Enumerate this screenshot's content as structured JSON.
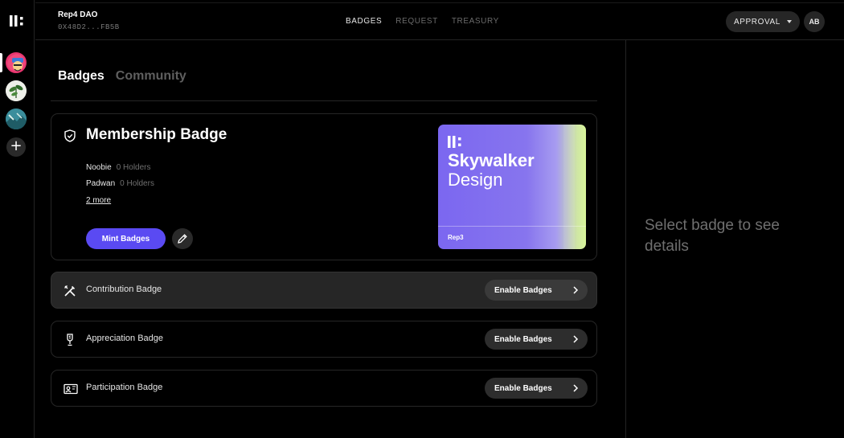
{
  "header": {
    "dao_name": "Rep4 DAO",
    "dao_address": "0X48D2...FB5B",
    "nav": [
      {
        "label": "BADGES",
        "active": true
      },
      {
        "label": "REQUEST",
        "active": false
      },
      {
        "label": "TREASURY",
        "active": false
      }
    ],
    "approval_label": "APPROVAL",
    "user_initials": "AB"
  },
  "rail": {
    "logo_icon": "rep3-logo-icon",
    "add_label": "+"
  },
  "tabs": [
    {
      "label": "Badges",
      "active": true
    },
    {
      "label": "Community",
      "active": false
    }
  ],
  "membership": {
    "title": "Membership Badge",
    "levels": [
      {
        "name": "Noobie",
        "holders": "0 Holders"
      },
      {
        "name": "Padwan",
        "holders": "0 Holders"
      }
    ],
    "more_link": "2 more",
    "mint_label": "Mint Badges",
    "preview": {
      "title": "Skywalker",
      "subtitle": "Design",
      "brand": "Rep3"
    }
  },
  "badge_rows": [
    {
      "label": "Contribution Badge",
      "button": "Enable Badges",
      "icon": "tools-icon"
    },
    {
      "label": "Appreciation Badge",
      "button": "Enable Badges",
      "icon": "trophy-icon"
    },
    {
      "label": "Participation Badge",
      "button": "Enable Badges",
      "icon": "id-card-icon"
    }
  ],
  "detail_panel": {
    "empty_text": "Select badge to see details"
  },
  "colors": {
    "accent": "#5a4af2",
    "background": "#000000",
    "muted": "#6f6f6f"
  }
}
